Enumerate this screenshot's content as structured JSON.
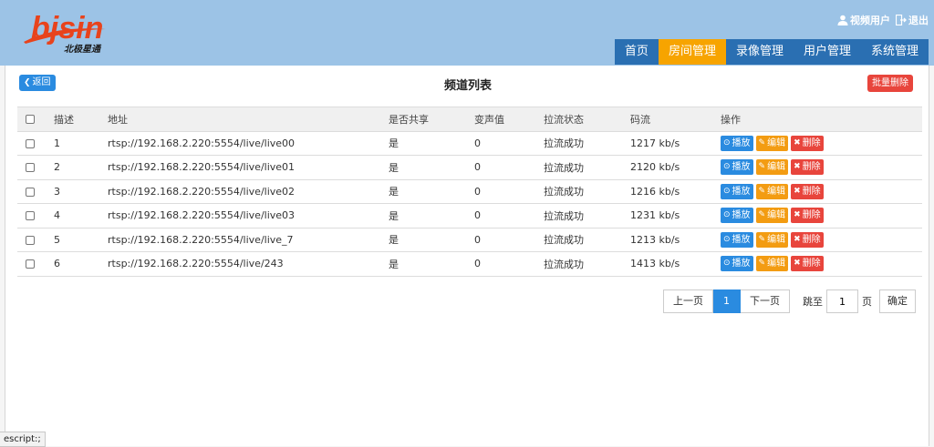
{
  "brand": {
    "logo_text": "bjsin",
    "logo_sub": "北极星通",
    "colors": {
      "header_bg": "#9cc3e6",
      "nav_bg": "#2a6fb2",
      "nav_active": "#f7a400",
      "primary": "#2a8be0",
      "warning": "#f39c12",
      "danger": "#e8453c"
    }
  },
  "user": {
    "name": "视频用户",
    "name_icon": "user-icon",
    "logout": "退出",
    "logout_icon": "logout-icon"
  },
  "nav": [
    {
      "label": "首页",
      "active": false
    },
    {
      "label": "房间管理",
      "active": true
    },
    {
      "label": "录像管理",
      "active": false
    },
    {
      "label": "用户管理",
      "active": false
    },
    {
      "label": "系统管理",
      "active": false
    }
  ],
  "page": {
    "back_label": "返回",
    "title": "频道列表",
    "batch_delete": "批量删除"
  },
  "table": {
    "headers": [
      "描述",
      "地址",
      "是否共享",
      "变声值",
      "拉流状态",
      "码流",
      "操作"
    ],
    "rows": [
      {
        "desc": "1",
        "addr": "rtsp://192.168.2.220:5554/live/live00",
        "share": "是",
        "voice": "0",
        "status": "拉流成功",
        "rate": "1217 kb/s"
      },
      {
        "desc": "2",
        "addr": "rtsp://192.168.2.220:5554/live/live01",
        "share": "是",
        "voice": "0",
        "status": "拉流成功",
        "rate": "2120 kb/s"
      },
      {
        "desc": "3",
        "addr": "rtsp://192.168.2.220:5554/live/live02",
        "share": "是",
        "voice": "0",
        "status": "拉流成功",
        "rate": "1216 kb/s"
      },
      {
        "desc": "4",
        "addr": "rtsp://192.168.2.220:5554/live/live03",
        "share": "是",
        "voice": "0",
        "status": "拉流成功",
        "rate": "1231 kb/s"
      },
      {
        "desc": "5",
        "addr": "rtsp://192.168.2.220:5554/live/live_7",
        "share": "是",
        "voice": "0",
        "status": "拉流成功",
        "rate": "1213 kb/s"
      },
      {
        "desc": "6",
        "addr": "rtsp://192.168.2.220:5554/live/243",
        "share": "是",
        "voice": "0",
        "status": "拉流成功",
        "rate": "1413 kb/s"
      }
    ],
    "actions": {
      "play": "播放",
      "edit": "编辑",
      "delete": "删除"
    }
  },
  "pager": {
    "prev": "上一页",
    "current": "1",
    "next": "下一页",
    "jump_label": "跳至",
    "jump_value": "1",
    "page_unit": "页",
    "confirm": "确定"
  },
  "statusbar": {
    "text": "escript:;"
  }
}
